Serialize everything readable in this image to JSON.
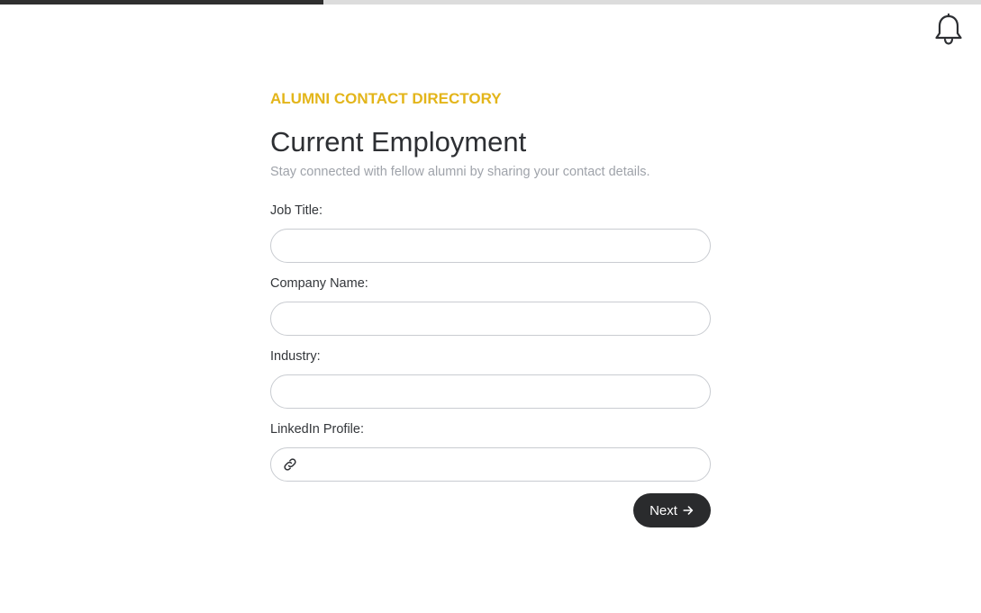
{
  "progress": {
    "fraction": 0.33
  },
  "header": {
    "notification_icon": "bell-icon"
  },
  "form": {
    "eyebrow": "ALUMNI CONTACT DIRECTORY",
    "title": "Current Employment",
    "subtitle": "Stay connected with fellow alumni by sharing your contact details.",
    "fields": [
      {
        "label": "Job Title:",
        "value": "",
        "placeholder": ""
      },
      {
        "label": "Company Name:",
        "value": "",
        "placeholder": ""
      },
      {
        "label": "Industry:",
        "value": "",
        "placeholder": ""
      },
      {
        "label": "LinkedIn Profile:",
        "value": "",
        "placeholder": "",
        "icon": "link-icon"
      }
    ],
    "next_label": "Next",
    "next_icon": "arrow-right-icon"
  },
  "colors": {
    "accent": "#e3b51a",
    "button": "#2a2b2d",
    "progress_fill": "#2f2f2f",
    "progress_track": "#dcdcdc"
  }
}
